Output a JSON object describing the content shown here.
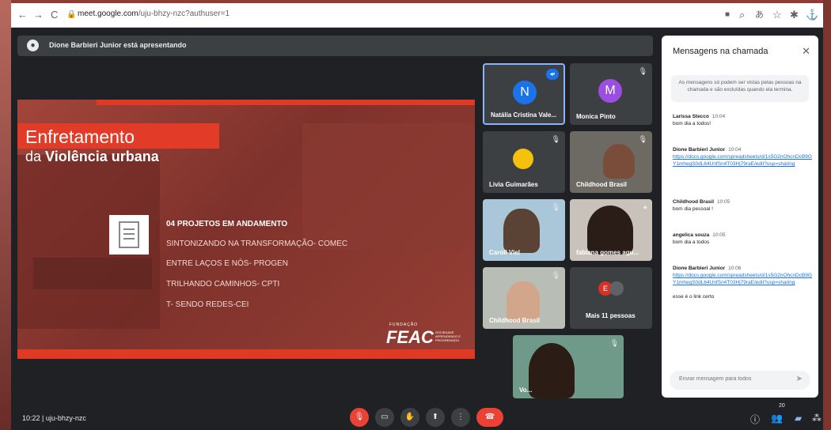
{
  "browser": {
    "url_host": "meet.google.com",
    "url_path": "/uju-bhzy-nzc?authuser=1"
  },
  "presenting": {
    "text": "Dione Barbieri Junior está apresentando"
  },
  "slide": {
    "title_line1": "Enfretamento",
    "title_line2_prefix": "da ",
    "title_line2_bold": "Violência urbana",
    "projects_header": "04 PROJETOS EM ANDAMENTO",
    "projects": [
      "SINTONIZANDO NA TRANSFORMAÇÃO- COMEC",
      "ENTRE LAÇOS E NÓS- PROGEN",
      "TRILHANDO CAMINHOS- CPTI",
      "T- SENDO REDES-CEI"
    ],
    "logo_top": "FUNDAÇÃO",
    "logo_main": "FEAC",
    "logo_side": "SOCIEDADE APRENDENDO E PROGREDINDO"
  },
  "participants": [
    {
      "name": "Natália Cristina Vale...",
      "initial": "N",
      "color": "#1a73e8"
    },
    {
      "name": "Monica Pinto",
      "initial": "M",
      "color": "#9c4ee0"
    },
    {
      "name": "Livia Guimarães"
    },
    {
      "name": "Childhood Brasil"
    },
    {
      "name": "Caroll Viel"
    },
    {
      "name": "fabiana gomes agu..."
    },
    {
      "name": "Childhood Brasil"
    },
    {
      "name": "Mais 11 pessoas",
      "initial": "E"
    },
    {
      "name": "Vo..."
    }
  ],
  "chat": {
    "title": "Mensagens na chamada",
    "note": "As mensagens só podem ser vistas pelas pessoas na chamada e são excluídas quando ela termina.",
    "messages": [
      {
        "sender": "Larissa Stecco",
        "time": "10:04",
        "text": "bom dia a todos!"
      },
      {
        "sender": "Dione Barbieri Junior",
        "time": "10:04",
        "text": "https://docs.google.com/spreadsheets/d/1s5G2nOhcnDcB9GY1mhegS0dL64UnfSn4T03Hj79raE/edit?usp=sharing"
      },
      {
        "sender": "Childhood Brasil",
        "time": "10:05",
        "text": "bom dia pessoal !"
      },
      {
        "sender": "angelica souza",
        "time": "10:05",
        "text": "bom dia a todos"
      },
      {
        "sender": "Dione Barbieri Junior",
        "time": "10:06",
        "text": "https://docs.google.com/spreadsheets/d/1s5G2nOhcnDcB9GY1mhegS0dL64UnfSn4T03Hj79raE/edit?usp=sharing",
        "text2": "esse é o link certo"
      }
    ],
    "input_placeholder": "Enviar mensagem para todos"
  },
  "bottombar": {
    "time": "10:22",
    "separator": "|",
    "meeting_code": "uju-bhzy-nzc",
    "participants_count": "20"
  }
}
